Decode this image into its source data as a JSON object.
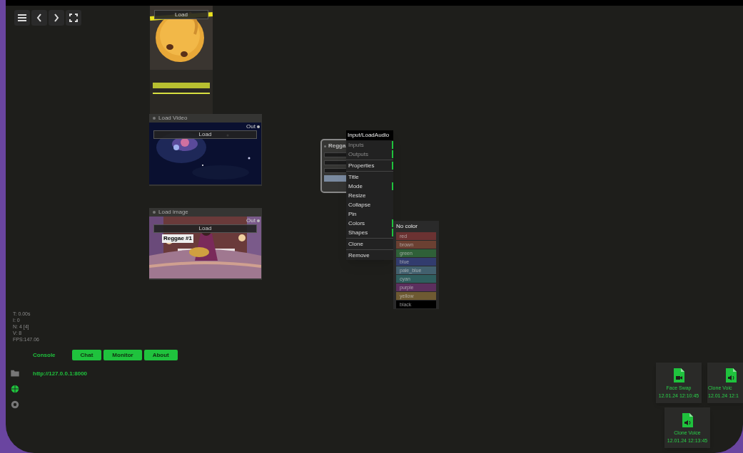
{
  "toolbar": [
    {
      "kind": "menu"
    },
    {
      "kind": "back"
    },
    {
      "kind": "forward"
    },
    {
      "kind": "fullscreen"
    }
  ],
  "nodes": [
    {
      "kind": "audio",
      "button": "Load"
    },
    {
      "kind": "video",
      "title": "Load Video",
      "output": "Out",
      "button": "Load"
    },
    {
      "title": "Load image",
      "output": "Out",
      "button": "Load",
      "tag": "Reggae #1"
    },
    {
      "kind": "audio_small",
      "title": "Regga"
    }
  ],
  "context_menu": {
    "title": "Input/LoadAudio",
    "groups": [
      [
        {
          "label": "Inputs",
          "disabled": true,
          "submenu": true
        },
        {
          "label": "Outputs",
          "disabled": true,
          "submenu": true
        }
      ],
      [
        {
          "label": "Properties",
          "disabled": false,
          "submenu": true
        }
      ],
      [
        {
          "label": "Title",
          "disabled": false,
          "submenu": false
        },
        {
          "label": "Mode",
          "disabled": false,
          "submenu": true
        },
        {
          "label": "Resize",
          "disabled": false,
          "submenu": false
        },
        {
          "label": "Collapse",
          "disabled": false,
          "submenu": false
        },
        {
          "label": "Pin",
          "disabled": false,
          "submenu": false
        },
        {
          "label": "Colors",
          "disabled": false,
          "submenu": true
        },
        {
          "label": "Shapes",
          "disabled": false,
          "submenu": true
        }
      ],
      [
        {
          "label": "Clone",
          "disabled": false,
          "submenu": false
        }
      ],
      [
        {
          "label": "Remove",
          "disabled": false,
          "submenu": false
        }
      ]
    ]
  },
  "color_menu": {
    "title": "No color",
    "items": [
      {
        "label": "red",
        "color": "#6b3232"
      },
      {
        "label": "brown",
        "color": "#6b4032"
      },
      {
        "label": "green",
        "color": "#2f6038"
      },
      {
        "label": "blue",
        "color": "#323c6e"
      },
      {
        "label": "pale_blue",
        "color": "#42606e"
      },
      {
        "label": "cyan",
        "color": "#2f5e5e"
      },
      {
        "label": "purple",
        "color": "#5c2f5e"
      },
      {
        "label": "yellow",
        "color": "#6e5a32"
      },
      {
        "label": "black",
        "color": "#000000"
      }
    ]
  },
  "stats": [
    "T: 0.00s",
    "I: 0",
    "N: 4 [4]",
    "V: 8",
    "FPS:147.06"
  ],
  "console": {
    "tabs": [
      {
        "label": "Console",
        "selected": true
      },
      {
        "label": "Chat",
        "selected": false
      },
      {
        "label": "Monitor",
        "selected": false
      },
      {
        "label": "About",
        "selected": false
      }
    ],
    "url": "http://127.0.0.1:8000"
  },
  "side_icons": [
    {
      "kind": "folder",
      "selected": false
    },
    {
      "kind": "globe",
      "selected": true
    },
    {
      "kind": "settings",
      "selected": false
    }
  ],
  "files": [
    [
      {
        "kind": "video",
        "name": "Face Swap",
        "time": "12.01.24 12:10:45"
      },
      {
        "kind": "audio",
        "name": "Clone Voic",
        "time": "12.01.24 12:1"
      }
    ],
    [
      {
        "kind": "audio",
        "name": "Clone Voice",
        "time": "12.01.24 12:13:45"
      }
    ]
  ]
}
